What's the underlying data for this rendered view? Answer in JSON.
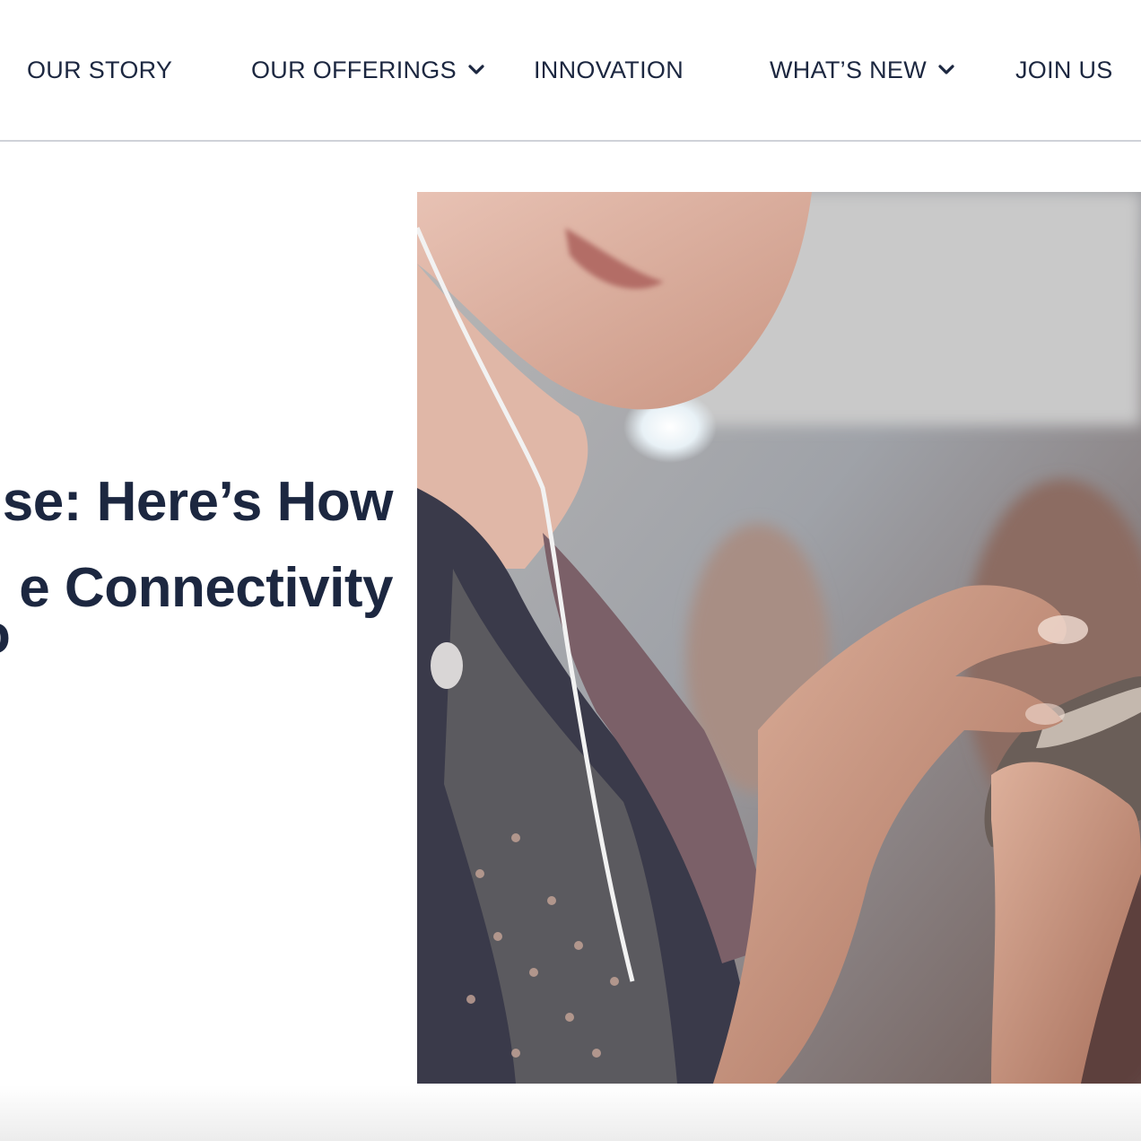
{
  "nav": {
    "items": [
      {
        "label": "OUR STORY",
        "has_dropdown": false
      },
      {
        "label": "OUR OFFERINGS",
        "has_dropdown": true
      },
      {
        "label": "INNOVATION",
        "has_dropdown": false
      },
      {
        "label": "WHAT’S NEW",
        "has_dropdown": true
      },
      {
        "label": "JOIN US",
        "has_dropdown": false
      }
    ]
  },
  "hero": {
    "headline_lines": [
      "se: Here’s How",
      "e Connectivity",
      "o"
    ],
    "image": "woman-with-earphones-using-smartphone-photo"
  },
  "colors": {
    "text": "#1c2740",
    "divider": "#cfd2d8",
    "background": "#ffffff"
  }
}
